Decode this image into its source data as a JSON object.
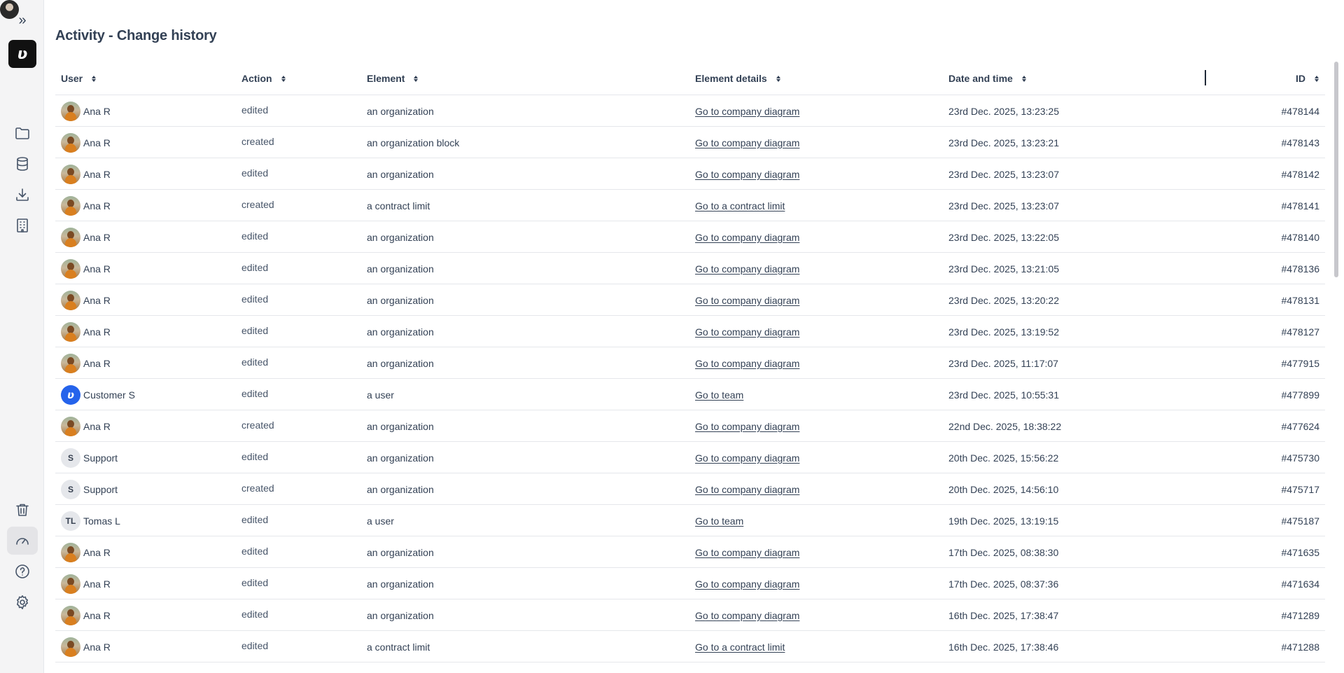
{
  "sidebar": {
    "expand_glyph": "»",
    "logo_glyph": "ʋ",
    "icons": [
      "folder-icon",
      "database-icon",
      "download-icon",
      "building-icon",
      "trash-icon",
      "gauge-icon",
      "help-icon",
      "gear-icon"
    ],
    "active_item": "gauge-icon"
  },
  "page": {
    "title": "Activity - Change history"
  },
  "table": {
    "columns": [
      "User",
      "Action",
      "Element",
      "Element details",
      "Date and time",
      "ID"
    ],
    "rows": [
      {
        "avatar": "photo",
        "initials": "",
        "user": "Ana R",
        "action": "edited",
        "element": "an organization",
        "details": "Go to company diagram",
        "date": "23rd Dec. 2025, 13:23:25",
        "id": "#478144"
      },
      {
        "avatar": "photo",
        "initials": "",
        "user": "Ana R",
        "action": "created",
        "element": "an organization block",
        "details": "Go to company diagram",
        "date": "23rd Dec. 2025, 13:23:21",
        "id": "#478143"
      },
      {
        "avatar": "photo",
        "initials": "",
        "user": "Ana R",
        "action": "edited",
        "element": "an organization",
        "details": "Go to company diagram",
        "date": "23rd Dec. 2025, 13:23:07",
        "id": "#478142"
      },
      {
        "avatar": "photo",
        "initials": "",
        "user": "Ana R",
        "action": "created",
        "element": "a contract limit",
        "details": "Go to a contract limit",
        "date": "23rd Dec. 2025, 13:23:07",
        "id": "#478141"
      },
      {
        "avatar": "photo",
        "initials": "",
        "user": "Ana R",
        "action": "edited",
        "element": "an organization",
        "details": "Go to company diagram",
        "date": "23rd Dec. 2025, 13:22:05",
        "id": "#478140"
      },
      {
        "avatar": "photo",
        "initials": "",
        "user": "Ana R",
        "action": "edited",
        "element": "an organization",
        "details": "Go to company diagram",
        "date": "23rd Dec. 2025, 13:21:05",
        "id": "#478136"
      },
      {
        "avatar": "photo",
        "initials": "",
        "user": "Ana R",
        "action": "edited",
        "element": "an organization",
        "details": "Go to company diagram",
        "date": "23rd Dec. 2025, 13:20:22",
        "id": "#478131"
      },
      {
        "avatar": "photo",
        "initials": "",
        "user": "Ana R",
        "action": "edited",
        "element": "an organization",
        "details": "Go to company diagram",
        "date": "23rd Dec. 2025, 13:19:52",
        "id": "#478127"
      },
      {
        "avatar": "photo",
        "initials": "",
        "user": "Ana R",
        "action": "edited",
        "element": "an organization",
        "details": "Go to company diagram",
        "date": "23rd Dec. 2025, 11:17:07",
        "id": "#477915"
      },
      {
        "avatar": "brand",
        "initials": "ʋ",
        "user": "Customer S",
        "action": "edited",
        "element": "a user",
        "details": "Go to team",
        "date": "23rd Dec. 2025, 10:55:31",
        "id": "#477899"
      },
      {
        "avatar": "photo",
        "initials": "",
        "user": "Ana R",
        "action": "created",
        "element": "an organization",
        "details": "Go to company diagram",
        "date": "22nd Dec. 2025, 18:38:22",
        "id": "#477624"
      },
      {
        "avatar": "initials",
        "initials": "S",
        "user": "Support",
        "action": "edited",
        "element": "an organization",
        "details": "Go to company diagram",
        "date": "20th Dec. 2025, 15:56:22",
        "id": "#475730"
      },
      {
        "avatar": "initials",
        "initials": "S",
        "user": "Support",
        "action": "created",
        "element": "an organization",
        "details": "Go to company diagram",
        "date": "20th Dec. 2025, 14:56:10",
        "id": "#475717"
      },
      {
        "avatar": "initials",
        "initials": "TL",
        "user": "Tomas L",
        "action": "edited",
        "element": "a user",
        "details": "Go to team",
        "date": "19th Dec. 2025, 13:19:15",
        "id": "#475187"
      },
      {
        "avatar": "photo",
        "initials": "",
        "user": "Ana R",
        "action": "edited",
        "element": "an organization",
        "details": "Go to company diagram",
        "date": "17th Dec. 2025, 08:38:30",
        "id": "#471635"
      },
      {
        "avatar": "photo",
        "initials": "",
        "user": "Ana R",
        "action": "edited",
        "element": "an organization",
        "details": "Go to company diagram",
        "date": "17th Dec. 2025, 08:37:36",
        "id": "#471634"
      },
      {
        "avatar": "photo",
        "initials": "",
        "user": "Ana R",
        "action": "edited",
        "element": "an organization",
        "details": "Go to company diagram",
        "date": "16th Dec. 2025, 17:38:47",
        "id": "#471289"
      },
      {
        "avatar": "photo",
        "initials": "",
        "user": "Ana R",
        "action": "edited",
        "element": "a contract limit",
        "details": "Go to a contract limit",
        "date": "16th Dec. 2025, 17:38:46",
        "id": "#471288"
      }
    ]
  },
  "colors": {
    "brand_blue": "#2563eb",
    "text": "#334155",
    "sidebar_bg": "#f4f4f5",
    "border": "#e5e7eb"
  }
}
